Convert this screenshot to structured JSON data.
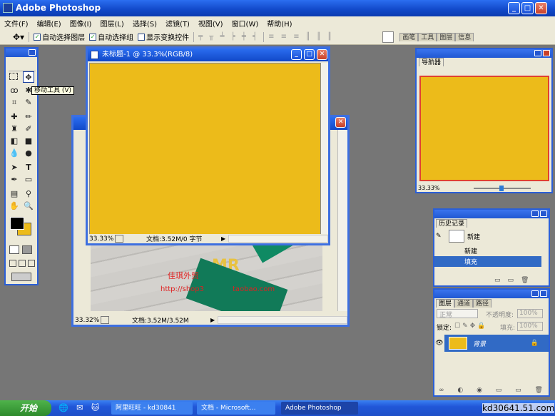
{
  "app": {
    "title": "Adobe Photoshop"
  },
  "menu": [
    "文件(F)",
    "编辑(E)",
    "图像(I)",
    "图层(L)",
    "选择(S)",
    "滤镜(T)",
    "视图(V)",
    "窗口(W)",
    "帮助(H)"
  ],
  "options": {
    "auto_select_layer": "自动选择图层",
    "auto_select_group": "自动选择组",
    "show_transform": "显示变换控件",
    "palette_tabs": [
      "画笔",
      "工具",
      "图层",
      "信息"
    ]
  },
  "tooltip": "移动工具 (V)",
  "doc_front": {
    "title": "未标题-1 @ 33.3%(RGB/8)",
    "zoom": "33.33%",
    "info": "文档:3.52M/0 字节",
    "fill": "#ecbb1a"
  },
  "doc_back": {
    "zoom": "33.32%",
    "info": "文档:3.52M/3.52M",
    "watermark1": "佳琪外贸",
    "watermark2": "http://shop3",
    "watermark3": "taobao.com",
    "shirt_letters": "MR"
  },
  "navigator": {
    "title": "导航器",
    "zoom": "33.33%",
    "frame_color": "#e04030"
  },
  "history": {
    "tab": "历史记录",
    "snapshot": "新建",
    "items": [
      "新建",
      "填充"
    ]
  },
  "layers": {
    "tabs": [
      "图层",
      "通道",
      "路径"
    ],
    "blend": "正常",
    "opacity_label": "不透明度:",
    "opacity": "100%",
    "lock_label": "锁定:",
    "fill_label": "填充:",
    "fill": "100%",
    "layer_name": "背景"
  },
  "taskbar": {
    "start": "开始",
    "items": [
      "阿里旺旺 - kd30841",
      "文档 - Microsoft...",
      "Adobe Photoshop"
    ]
  },
  "site_watermark": "kd30641.51.com"
}
